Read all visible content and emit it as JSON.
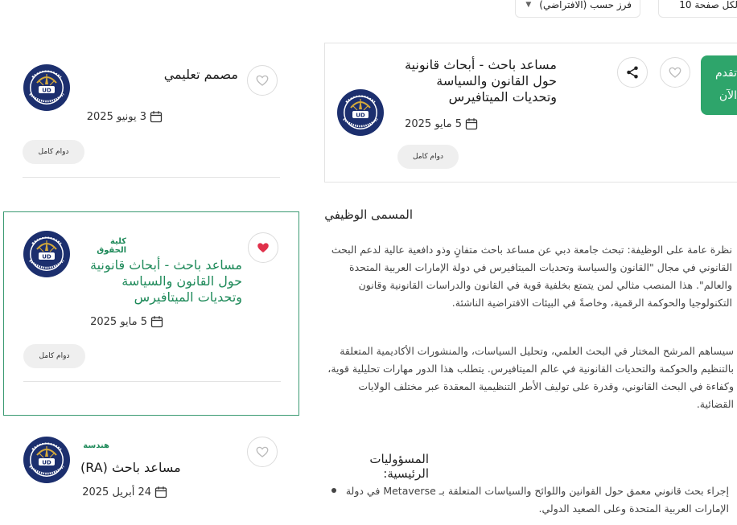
{
  "toolbar": {
    "sort_label": "فرز حسب (الافتراضي)",
    "per_page_label": "لكل صفحة 10"
  },
  "job_list": [
    {
      "title": "مصمم تعليمي",
      "category": "",
      "date": "3 يونيو 2025",
      "type": "دوام كامل",
      "favorited": false
    },
    {
      "title": "مساعد باحث - أبحاث قانونية حول القانون والسياسة وتحديات الميتافيرس",
      "category": "كلية الحقوق",
      "date": "5 مايو 2025",
      "type": "دوام كامل",
      "favorited": true
    },
    {
      "title": "مساعد باحث (RA)",
      "category": "هندسة",
      "date": "24 أبريل 2025",
      "type": "",
      "favorited": false
    }
  ],
  "detail": {
    "title": "مساعد باحث - أبحاث قانونية حول القانون والسياسة وتحديات الميتافيرس",
    "date": "5 مايو 2025",
    "type": "دوام كامل",
    "apply_label": "تقدم الآن",
    "section_job_title": "المسمى الوظيفي",
    "overview": "نظرة عامة على الوظيفة: تبحث جامعة دبي عن مساعد باحث متفانٍ وذو دافعية عالية لدعم البحث القانوني في مجال \"القانون والسياسة وتحديات الميتافيرس في دولة الإمارات العربية المتحدة والعالم\". هذا المنصب مثالي لمن يتمتع بخلفية قوية في القانون والدراسات القانونية وقانون التكنولوجيا والحوكمة الرقمية، وخاصةً في البيئات الافتراضية الناشئة.",
    "contribution": "سيساهم المرشح المختار في البحث العلمي، وتحليل السياسات، والمنشورات الأكاديمية المتعلقة بالتنظيم والحوكمة والتحديات القانونية في عالم الميتافيرس. يتطلب هذا الدور مهارات تحليلية قوية، وكفاءة في البحث القانوني، وقدرة على توليف الأطر التنظيمية المعقدة عبر مختلف الولايات القضائية.",
    "section_responsibilities": "المسؤوليات الرئيسية:",
    "responsibility_1": "إجراء بحث قانوني معمق حول القوانين واللوائح والسياسات المتعلقة بـ Metaverse في دولة الإمارات العربية المتحدة وعلى الصعيد الدولي."
  },
  "colors": {
    "accent_green": "#2ea56b",
    "heart_red": "#e0304a"
  }
}
